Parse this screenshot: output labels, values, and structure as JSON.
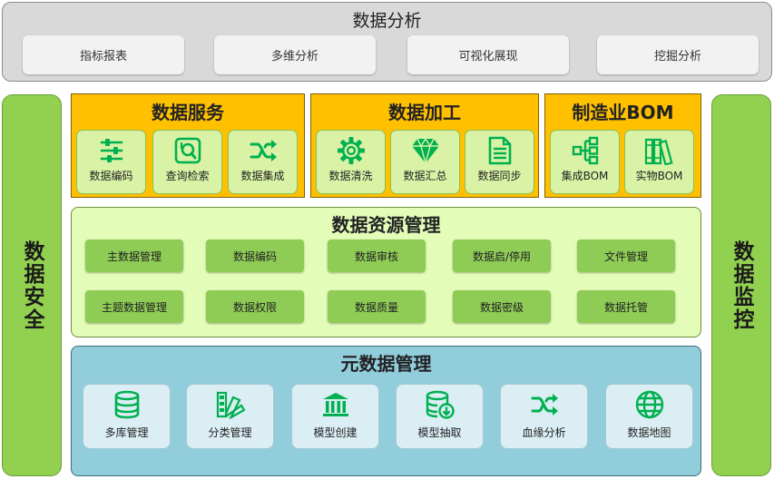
{
  "analysis": {
    "title": "数据分析",
    "items": [
      "指标报表",
      "多维分析",
      "可视化展现",
      "挖掘分析"
    ]
  },
  "left_pillar": "数据安全",
  "right_pillar": "数据监控",
  "service": {
    "title": "数据服务",
    "items": [
      {
        "label": "数据编码",
        "icon": "sliders-icon"
      },
      {
        "label": "查询检索",
        "icon": "search-icon"
      },
      {
        "label": "数据集成",
        "icon": "shuffle-icon"
      }
    ]
  },
  "processing": {
    "title": "数据加工",
    "items": [
      {
        "label": "数据清洗",
        "icon": "gear-icon"
      },
      {
        "label": "数据汇总",
        "icon": "gem-icon"
      },
      {
        "label": "数据同步",
        "icon": "document-icon"
      }
    ]
  },
  "bom": {
    "title": "制造业BOM",
    "items": [
      {
        "label": "集成BOM",
        "icon": "hierarchy-icon"
      },
      {
        "label": "实物BOM",
        "icon": "books-icon"
      }
    ]
  },
  "resource": {
    "title": "数据资源管理",
    "row1": [
      "主数据管理",
      "数据编码",
      "数据审核",
      "数据启/停用",
      "文件管理"
    ],
    "row2": [
      "主题数据管理",
      "数据权限",
      "数据质量",
      "数据密级",
      "数据托管"
    ]
  },
  "metadata": {
    "title": "元数据管理",
    "items": [
      {
        "label": "多库管理",
        "icon": "database-icon"
      },
      {
        "label": "分类管理",
        "icon": "classify-icon"
      },
      {
        "label": "模型创建",
        "icon": "bank-icon"
      },
      {
        "label": "模型抽取",
        "icon": "database-download-icon"
      },
      {
        "label": "血缘分析",
        "icon": "shuffle-icon"
      },
      {
        "label": "数据地图",
        "icon": "globe-icon"
      }
    ]
  },
  "colors": {
    "icon_green": "#00b050",
    "orange": "#ffc000",
    "pillar_green": "#92d050",
    "resource_bg": "#e3fdb8",
    "metadata_bg": "#92cddc"
  }
}
